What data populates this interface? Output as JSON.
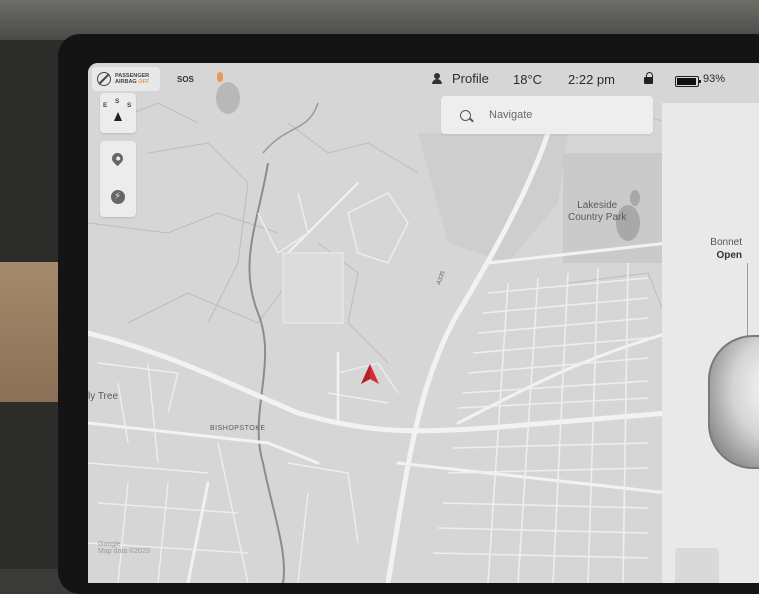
{
  "status_bar": {
    "airbag_line1": "PASSENGER",
    "airbag_line2": "AIRBAG",
    "airbag_state": "OFF",
    "sos": "SOS",
    "profile": "Profile",
    "temperature": "18°C",
    "time": "2:22 pm",
    "battery": "93%"
  },
  "search": {
    "placeholder": "Navigate"
  },
  "compass": {
    "letters": [
      "E",
      "S",
      "S"
    ]
  },
  "map_labels": {
    "lakeside_line1": "Lakeside",
    "lakeside_line2": "Country Park",
    "fly_tree": "ly Tree",
    "bishopstoke": "BISHOPSTOKE",
    "road": "A335",
    "attribution_1": "Google",
    "attribution_2": "Map data ©2023"
  },
  "vehicle_panel": {
    "part": "Bonnet",
    "state": "Open"
  },
  "colors": {
    "accent": "#d62b35",
    "airbag_off": "#e09a4c",
    "map_bg": "#d7d6d6"
  },
  "icons": [
    "airbag-icon",
    "sos-icon",
    "person-icon",
    "lock-icon",
    "battery-icon",
    "search-icon",
    "compass-icon",
    "location-pin-icon",
    "charging-icon",
    "navigation-arrow-icon"
  ]
}
